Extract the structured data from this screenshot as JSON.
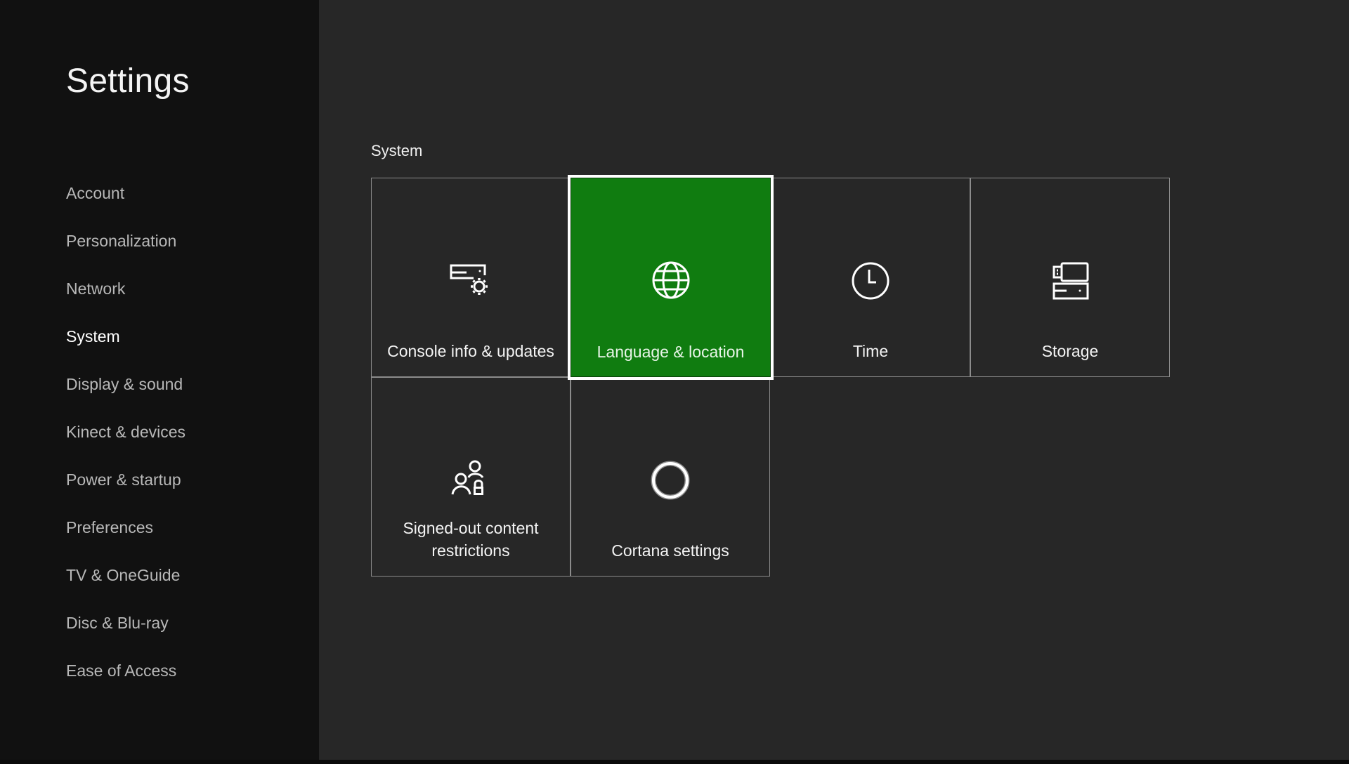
{
  "app": {
    "title": "Settings"
  },
  "sidebar": {
    "items": [
      {
        "label": "Account",
        "active": false
      },
      {
        "label": "Personalization",
        "active": false
      },
      {
        "label": "Network",
        "active": false
      },
      {
        "label": "System",
        "active": true
      },
      {
        "label": "Display & sound",
        "active": false
      },
      {
        "label": "Kinect & devices",
        "active": false
      },
      {
        "label": "Power & startup",
        "active": false
      },
      {
        "label": "Preferences",
        "active": false
      },
      {
        "label": "TV & OneGuide",
        "active": false
      },
      {
        "label": "Disc & Blu-ray",
        "active": false
      },
      {
        "label": "Ease of Access",
        "active": false
      }
    ]
  },
  "main": {
    "section_title": "System",
    "tiles": [
      {
        "label": "Console info & updates",
        "icon": "console-settings-icon",
        "selected": false
      },
      {
        "label": "Language & location",
        "icon": "globe-icon",
        "selected": true
      },
      {
        "label": "Time",
        "icon": "clock-icon",
        "selected": false
      },
      {
        "label": "Storage",
        "icon": "storage-icon",
        "selected": false
      },
      {
        "label": "Signed-out content restrictions",
        "icon": "users-lock-icon",
        "selected": false
      },
      {
        "label": "Cortana settings",
        "icon": "cortana-icon",
        "selected": false
      }
    ]
  },
  "colors": {
    "accent": "#107c10",
    "sidebar_bg": "#111111",
    "main_bg": "#272727",
    "tile_border": "#8c8c8c"
  }
}
